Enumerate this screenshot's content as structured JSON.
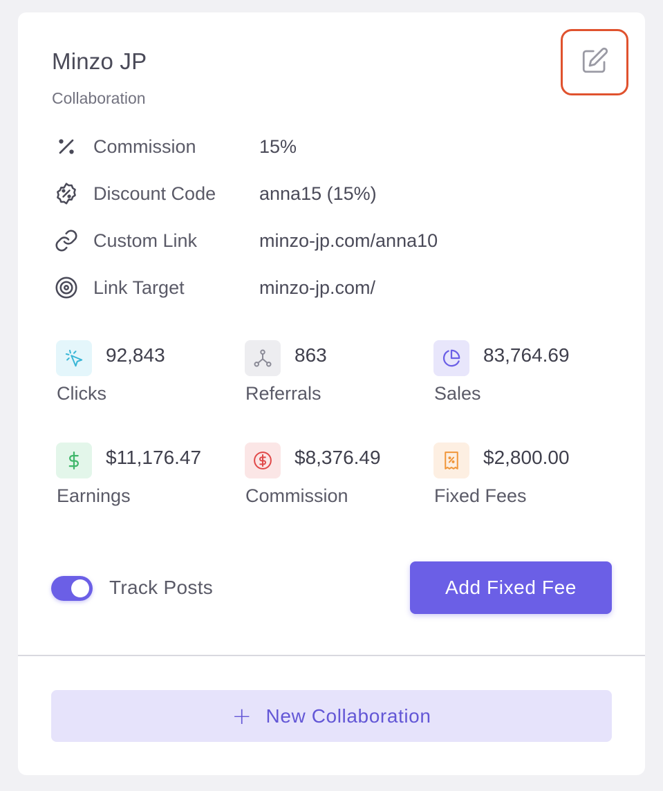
{
  "card": {
    "title": "Minzo JP",
    "subtitle": "Collaboration",
    "edit_icon": "edit-icon"
  },
  "details": [
    {
      "icon": "percent-icon",
      "label": "Commission",
      "value": "15%"
    },
    {
      "icon": "discount-badge-icon",
      "label": "Discount Code",
      "value": "anna15 (15%)"
    },
    {
      "icon": "link-icon",
      "label": "Custom Link",
      "value": "minzo-jp.com/anna10"
    },
    {
      "icon": "target-icon",
      "label": "Link Target",
      "value": "minzo-jp.com/"
    }
  ],
  "stats": [
    {
      "icon": "cursor-click-icon",
      "value": "92,843",
      "label": "Clicks",
      "color": "#38b6d6",
      "bg": "#e4f6fb"
    },
    {
      "icon": "network-icon",
      "value": "863",
      "label": "Referrals",
      "color": "#8a8a96",
      "bg": "#ededf0"
    },
    {
      "icon": "pie-chart-icon",
      "value": "83,764.69",
      "label": "Sales",
      "color": "#6b5fe6",
      "bg": "#e8e6fb"
    },
    {
      "icon": "dollar-icon",
      "value": "$11,176.47",
      "label": "Earnings",
      "color": "#3fb66a",
      "bg": "#e3f6ea"
    },
    {
      "icon": "dollar-circle-icon",
      "value": "$8,376.49",
      "label": "Commission",
      "color": "#e04848",
      "bg": "#fbe6e6"
    },
    {
      "icon": "receipt-icon",
      "value": "$2,800.00",
      "label": "Fixed Fees",
      "color": "#f0963a",
      "bg": "#fdefe2"
    }
  ],
  "track_posts": {
    "label": "Track Posts",
    "enabled": true
  },
  "buttons": {
    "add_fixed_fee": "Add Fixed Fee",
    "new_collaboration": "New Collaboration"
  },
  "colors": {
    "accent": "#6b5fe6",
    "edit_highlight": "#e0522e"
  }
}
